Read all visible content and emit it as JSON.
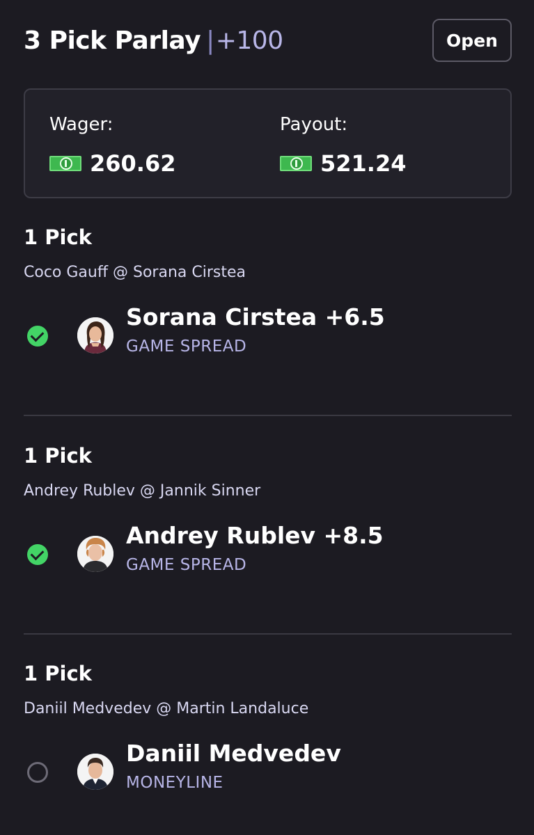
{
  "header": {
    "title": "3 Pick Parlay",
    "separator": "|",
    "odds": "+100",
    "open_label": "Open"
  },
  "summary": {
    "wager_label": "Wager:",
    "wager_amount": "260.62",
    "payout_label": "Payout:",
    "payout_amount": "521.24",
    "currency_icon": "cash-icon"
  },
  "picks": [
    {
      "title": "1 Pick",
      "matchup": "Coco Gauff @ Sorana Cirstea",
      "selection": "Sorana Cirstea +6.5",
      "market": "GAME SPREAD",
      "status": "won"
    },
    {
      "title": "1 Pick",
      "matchup": "Andrey Rublev @ Jannik Sinner",
      "selection": "Andrey Rublev +8.5",
      "market": "GAME SPREAD",
      "status": "won"
    },
    {
      "title": "1 Pick",
      "matchup": "Daniil Medvedev @ Martin Landaluce",
      "selection": "Daniil Medvedev",
      "market": "MONEYLINE",
      "status": "pending"
    }
  ],
  "colors": {
    "background": "#1c1b22",
    "accent": "#b8b6e8",
    "won": "#43d466"
  }
}
